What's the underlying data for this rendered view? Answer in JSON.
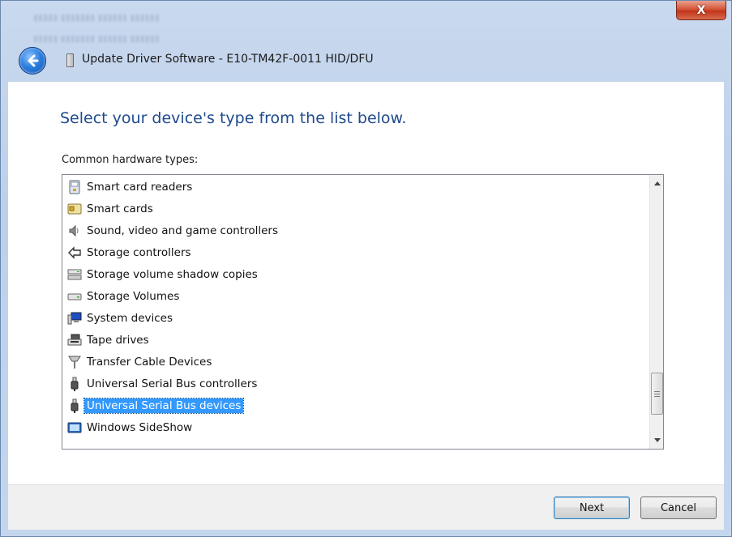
{
  "window": {
    "title": "Update Driver Software - E10-TM42F-0011 HID/DFU",
    "close_glyph": "X"
  },
  "main": {
    "heading": "Select your device's type from the list below.",
    "list_label": "Common hardware types:",
    "items": [
      {
        "label": "Smart card readers",
        "icon": "smart-card-reader-icon"
      },
      {
        "label": "Smart cards",
        "icon": "smart-card-icon"
      },
      {
        "label": "Sound, video and game controllers",
        "icon": "speaker-icon"
      },
      {
        "label": "Storage controllers",
        "icon": "storage-controller-icon"
      },
      {
        "label": "Storage volume shadow copies",
        "icon": "shadow-copy-icon"
      },
      {
        "label": "Storage Volumes",
        "icon": "storage-volume-icon"
      },
      {
        "label": "System devices",
        "icon": "system-device-icon"
      },
      {
        "label": "Tape drives",
        "icon": "tape-drive-icon"
      },
      {
        "label": "Transfer Cable Devices",
        "icon": "transfer-cable-icon"
      },
      {
        "label": "Universal Serial Bus controllers",
        "icon": "usb-plug-icon"
      },
      {
        "label": "Universal Serial Bus devices",
        "icon": "usb-plug-icon",
        "selected": true
      },
      {
        "label": "Windows SideShow",
        "icon": "sideshow-icon"
      }
    ]
  },
  "footer": {
    "next_label": "Next",
    "cancel_label": "Cancel"
  },
  "colors": {
    "heading": "#1f4a8c",
    "selection": "#3399ff"
  }
}
